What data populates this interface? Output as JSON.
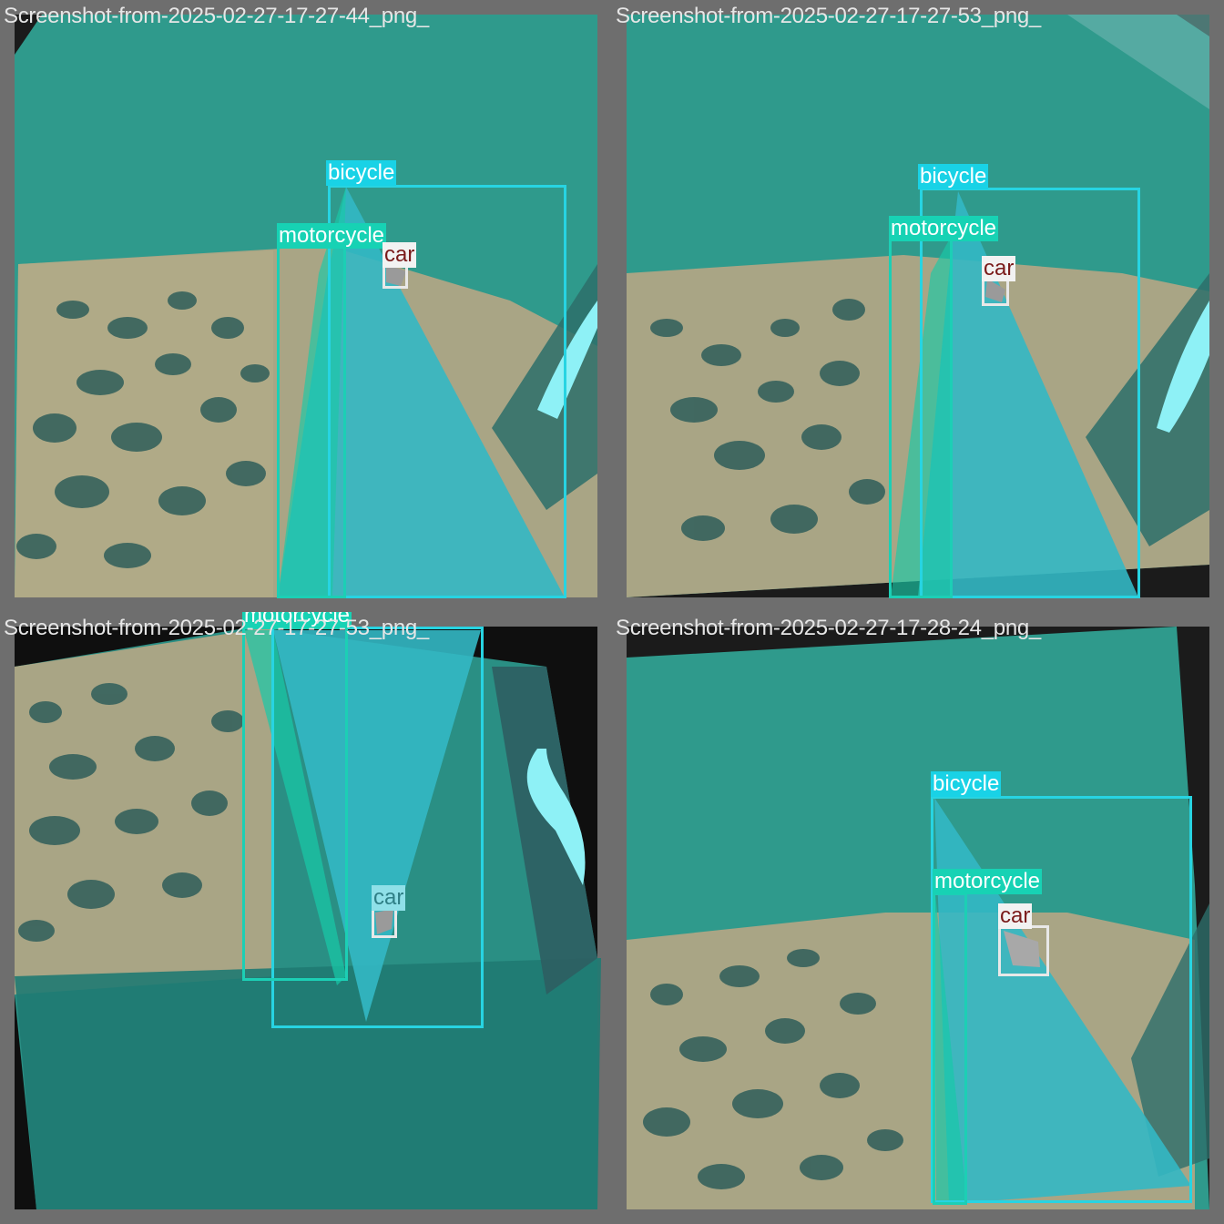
{
  "tiles": [
    {
      "filename": "Screenshot-from-2025-02-27-17-27-44_png_",
      "labels": {
        "bicycle": "bicycle",
        "motorcycle": "motorcycle",
        "car": "car"
      }
    },
    {
      "filename": "Screenshot-from-2025-02-27-17-27-53_png_",
      "labels": {
        "bicycle": "bicycle",
        "motorcycle": "motorcycle",
        "car": "car"
      }
    },
    {
      "filename": "Screenshot-from-2025-02-27-17-27-53_png_",
      "labels": {
        "motorcycle": "motorcycle",
        "car": "car"
      }
    },
    {
      "filename": "Screenshot-from-2025-02-27-17-28-24_png_",
      "labels": {
        "bicycle": "bicycle",
        "motorcycle": "motorcycle",
        "car": "car"
      }
    }
  ],
  "colors": {
    "bicycle": "#19d2e6",
    "motorcycle": "#17d2b4",
    "car": "#f2f2f2",
    "car_text": "#7a1a1a"
  }
}
